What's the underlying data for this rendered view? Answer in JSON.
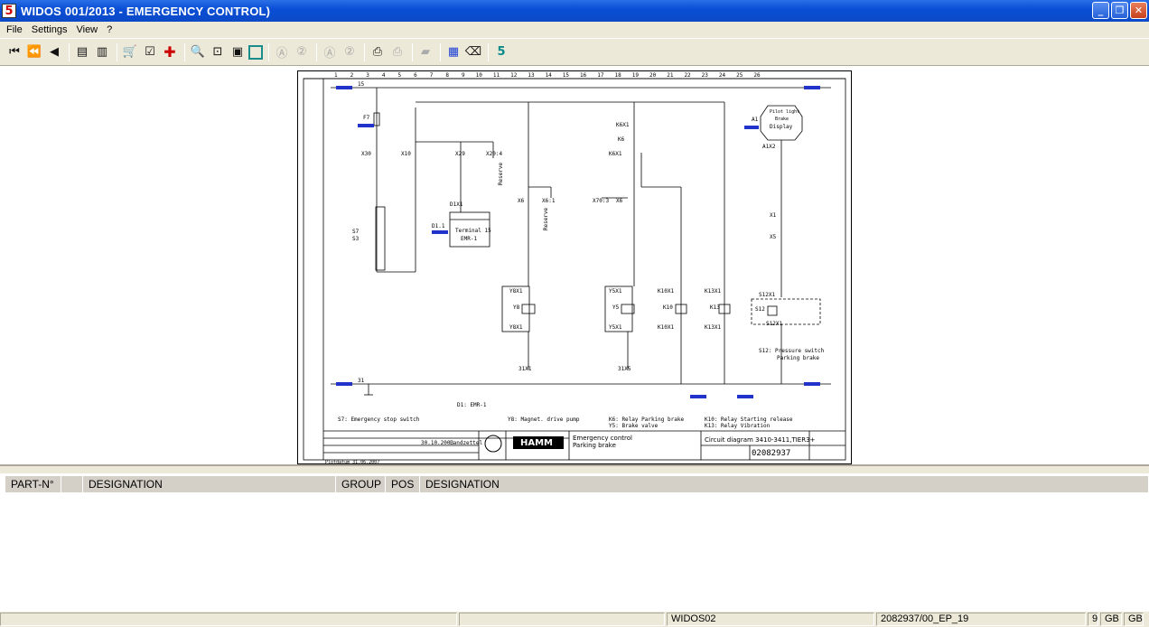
{
  "window": {
    "title": "WIDOS 001/2013 - EMERGENCY CONTROL)",
    "app_icon": "widos-app-icon"
  },
  "menu": [
    "File",
    "Settings",
    "View",
    "?"
  ],
  "toolbar": {
    "icons": [
      "first-page-icon",
      "prev-chapter-icon",
      "prev-page-icon",
      "toc-icon",
      "index-icon",
      "cart-icon",
      "order-list-icon",
      "add-icon",
      "zoom-in-icon",
      "zoom-fit-icon",
      "zoom-page-icon",
      "zoom-width-icon",
      "circle-a-icon",
      "circle-2-icon",
      "circle-a2-icon",
      "circle-2b-icon",
      "print-icon",
      "print-preview-icon",
      "bookmark-icon",
      "select-icon",
      "eraser-icon",
      "widos-logo-icon"
    ]
  },
  "drawing": {
    "column_numbers": [
      "1",
      "2",
      "3",
      "4",
      "5",
      "6",
      "7",
      "8",
      "9",
      "10",
      "11",
      "12",
      "13",
      "14",
      "15",
      "16",
      "17",
      "18",
      "19",
      "20",
      "21",
      "22",
      "23",
      "24",
      "25",
      "26"
    ],
    "labels": {
      "f7": "F7",
      "x30": "X30",
      "x10": "X10",
      "x29": "X29",
      "x20_4": "X20:4",
      "reserve1": "Reserve",
      "s7": "S7",
      "s3": "S3",
      "d1x1": "D1X1",
      "terminal": "Terminal 15",
      "emr": "EMR-1",
      "d1": "D1.1",
      "x6a": "X6",
      "x6_1": "X6:1",
      "reserve2": "Reserve",
      "x70_3": "X70:3",
      "x6b": "X6",
      "k6x1a": "K6X1",
      "k6": "K6",
      "k6x1b": "K6X1",
      "y8x1a": "Y8X1",
      "y8": "Y8",
      "y8x1b": "Y8X1",
      "y5x1a": "Y5X1",
      "y5": "Y5",
      "y5x1b": "Y5X1",
      "k10x1a": "K10X1",
      "k10": "K10",
      "k10x1b": "K10X1",
      "k13x1a": "K13X1",
      "k13": "K13",
      "k13x1b": "K13X1",
      "a1": "A1",
      "pilot": "Pilot light",
      "brake": "Brake",
      "display": "Display",
      "a1x2": "A1X2",
      "x1": "X1",
      "x5": "X5",
      "s12x1a": "S12X1",
      "s12": "S12",
      "s12x1b": "S12X1",
      "s12_desc1": "S12: Pressure switch",
      "s12_desc2": "Parking brake",
      "d1_desc": "D1: EMR-1",
      "legend_s7": "S7: Emergency stop switch",
      "legend_y8": "Y8: Magnet. drive pump",
      "legend_k6": "K6: Relay Parking brake",
      "legend_y5": "Y5: Brake valve",
      "legend_k10": "K10: Relay Starting release",
      "legend_k13": "K13: Relay Vibration",
      "x31a": "31X1",
      "x31b": "31X5",
      "tb_title1": "Emergency control",
      "tb_title2": "Parking brake",
      "tb_diagram": "Circuit diagram 3410-3411,TIER3+",
      "tb_number": "02082937",
      "tb_brand": "HAMM",
      "tb_date": "30.10.2003",
      "tb_name": "Landzettel",
      "plotdate": "Plotdatum 31.06.2007",
      "row15": "15",
      "row31": "31"
    }
  },
  "parts_list": {
    "columns": [
      "PART-N°",
      "",
      "DESIGNATION",
      "GROUP",
      "POS",
      "DESIGNATION"
    ]
  },
  "statusbar": {
    "fields": [
      "",
      "",
      "WIDOS02",
      "2082937/00_EP_19",
      "9",
      "GB",
      "GB"
    ]
  }
}
